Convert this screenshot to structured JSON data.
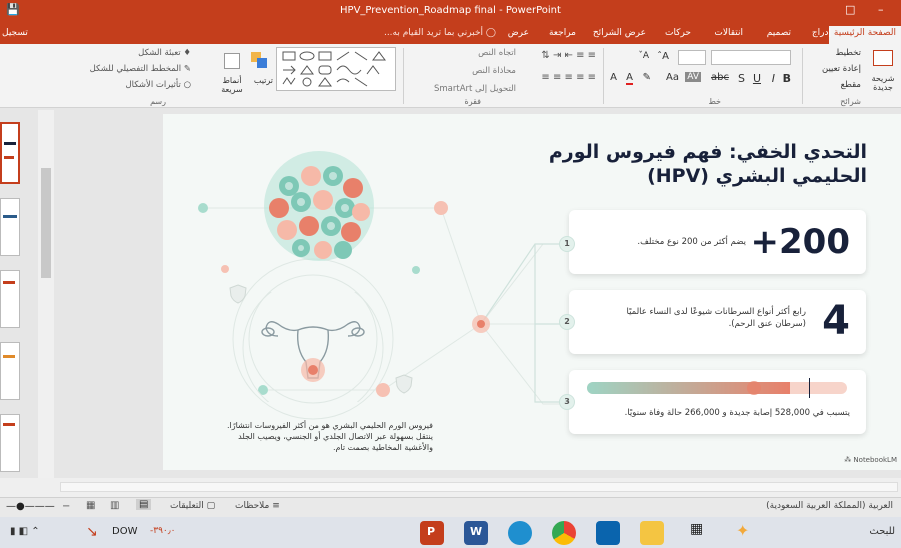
{
  "window": {
    "title": "HPV_Prevention_Roadmap final - PowerPoint"
  },
  "tabs": {
    "items": [
      "الصفحة الرئيسية",
      "إدراج",
      "تصميم",
      "انتقالات",
      "حركات",
      "عرض الشرائح",
      "مراجعة",
      "عرض"
    ],
    "tell_me": "أخبرني بما تريد القيام به...",
    "share": "تسجيل"
  },
  "ribbon": {
    "slides": {
      "new": "شريحة جديدة",
      "layout": "تخطيط",
      "reset": "إعادة تعيين",
      "section": "مقطع",
      "group": "شرائح"
    },
    "font": {
      "group": "خط"
    },
    "paragraph": {
      "text_direction": "اتجاه النص",
      "align_text": "محاذاة النص",
      "smartart": "التحويل إلى SmartArt",
      "group": "فقرة"
    },
    "drawing": {
      "arrange": "ترتيب",
      "quick_styles": "أنماط سريعة",
      "shape_fill": "تعبئة الشكل",
      "shape_outline": "المخطط التفصيلي للشكل",
      "shape_effects": "تأثيرات الأشكال",
      "group": "رسم"
    }
  },
  "slide": {
    "title_line1": "التحدي الخفي: فهم فيروس الورم",
    "title_line2": "الحليمي البشري (HPV)",
    "cards": [
      {
        "num": "1",
        "big": "+200",
        "text": "يضم أكثر من 200 نوع مختلف."
      },
      {
        "num": "2",
        "big": "4",
        "text": "رابع أكثر أنواع السرطانات شيوعًا لدى النساء عالميًا (سرطان عنق الرحم)."
      },
      {
        "num": "3",
        "big": "",
        "text": "يتسبب في 528,000 إصابة جديدة و 266,000 حالة وفاة سنويًا.",
        "progress": 0.78
      }
    ],
    "caption": "فيروس الورم الحليمي البشري هو من أكثر الفيروسات انتشارًا. ينتقل بسهولة عبر الاتصال الجلدي أو الجنسي، ويصيب الجلد والأغشية المخاطية بصمت تام.",
    "watermark": "NotebookLM",
    "colors": {
      "accent": "#e8806a",
      "teal": "#7ec8b6",
      "dark": "#18213a"
    }
  },
  "status": {
    "notes": "ملاحظات",
    "comments": "التعليقات",
    "language": "العربية (المملكة العربية السعودية)"
  },
  "taskbar": {
    "search": "للبحث",
    "ticker": "DOW",
    "change": "-٣٩٠٫٠"
  }
}
